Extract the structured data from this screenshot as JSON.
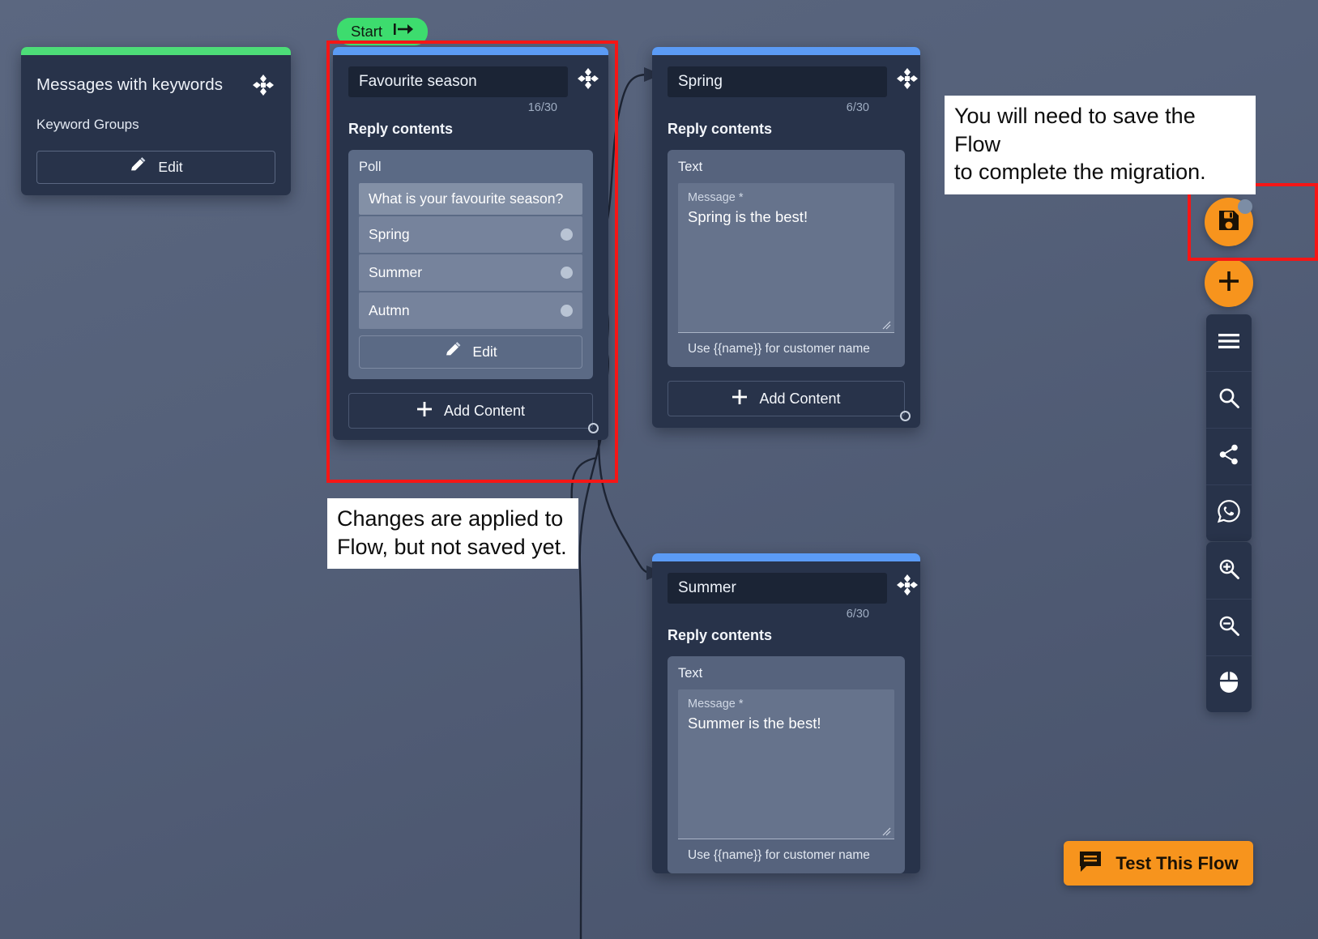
{
  "canvas": {
    "start_badge": {
      "label": "Start",
      "icon": "flow-start-arrow-icon"
    }
  },
  "nodes": {
    "keyword": {
      "title": "Messages with keywords",
      "subtitle": "Keyword Groups",
      "edit_label": "Edit",
      "accent_color": "#4ddd78"
    },
    "poll": {
      "title_value": "Favourite season",
      "title_placeholder": "Node title",
      "char_count": "16/30",
      "section_label": "Reply contents",
      "block_kind": "Poll",
      "question": "What is your favourite season?",
      "options": [
        "Spring",
        "Summer",
        "Autmn"
      ],
      "edit_label": "Edit",
      "add_content_label": "Add Content",
      "accent_color": "#5b9bf5"
    },
    "spring": {
      "title_value": "Spring",
      "title_placeholder": "Node title",
      "char_count": "6/30",
      "section_label": "Reply contents",
      "block_kind": "Text",
      "message_label": "Message *",
      "message_value": "Spring is the best!",
      "hint": "Use {{name}} for customer name",
      "add_content_label": "Add Content",
      "accent_color": "#5b9bf5"
    },
    "summer": {
      "title_value": "Summer",
      "title_placeholder": "Node title",
      "char_count": "6/30",
      "section_label": "Reply contents",
      "block_kind": "Text",
      "message_label": "Message *",
      "message_value": "Summer is the best!",
      "hint": "Use {{name}} for customer name",
      "accent_color": "#5b9bf5"
    }
  },
  "annotations": {
    "save_note": "You will need to save the Flow\nto complete the migration.",
    "changes_note": "Changes are applied to\nFlow, but not saved yet.",
    "highlight_color": "#f51616"
  },
  "action_buttons": {
    "save": {
      "icon": "save-disk-icon",
      "badge": true
    },
    "add": {
      "icon": "plus-icon"
    }
  },
  "toolbar_top": [
    {
      "icon": "hamburger-menu-icon"
    },
    {
      "icon": "search-icon"
    },
    {
      "icon": "share-icon"
    },
    {
      "icon": "whatsapp-icon"
    }
  ],
  "toolbar_bottom": [
    {
      "icon": "zoom-in-icon"
    },
    {
      "icon": "zoom-out-icon"
    },
    {
      "icon": "mouse-pointer-icon"
    }
  ],
  "test_flow": {
    "label": "Test This Flow",
    "icon": "chat-bubble-icon",
    "color": "#f7941d"
  }
}
